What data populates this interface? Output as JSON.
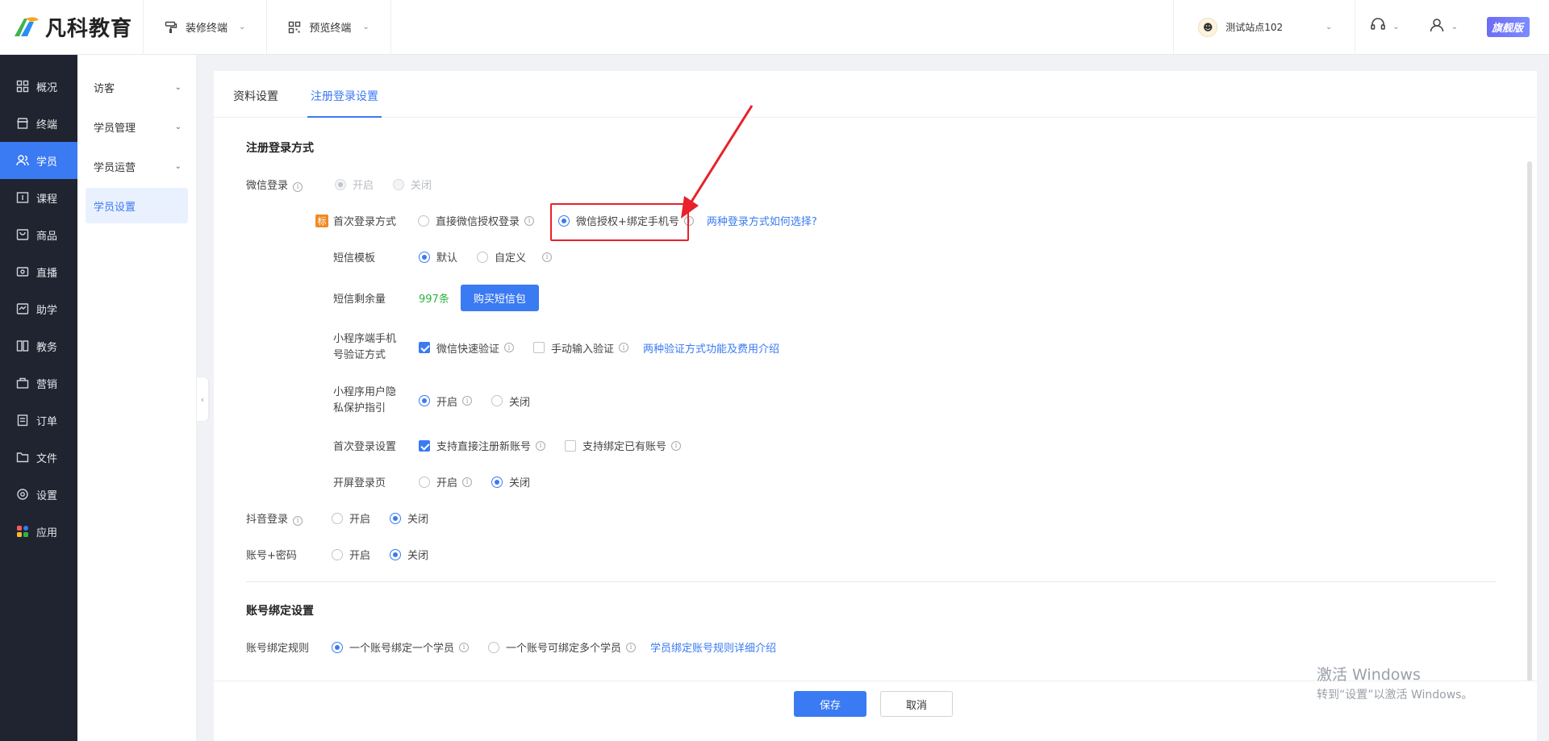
{
  "brand": {
    "name": "凡科教育"
  },
  "topbar": {
    "menus": [
      {
        "label": "装修终端"
      },
      {
        "label": "预览终端"
      }
    ],
    "site": {
      "name": "测试站点102"
    },
    "edition": "旗舰版"
  },
  "leftnav": {
    "items": [
      {
        "label": "概况",
        "icon": "grid-icon"
      },
      {
        "label": "终端",
        "icon": "store-icon"
      },
      {
        "label": "学员",
        "icon": "users-icon",
        "active": true
      },
      {
        "label": "课程",
        "icon": "course-icon"
      },
      {
        "label": "商品",
        "icon": "goods-icon"
      },
      {
        "label": "直播",
        "icon": "live-icon"
      },
      {
        "label": "助学",
        "icon": "assist-icon"
      },
      {
        "label": "教务",
        "icon": "book-icon"
      },
      {
        "label": "营销",
        "icon": "marketing-icon"
      },
      {
        "label": "订单",
        "icon": "order-icon"
      },
      {
        "label": "文件",
        "icon": "folder-icon"
      },
      {
        "label": "设置",
        "icon": "settings-icon"
      },
      {
        "label": "应用",
        "icon": "apps-icon"
      }
    ]
  },
  "subnav": {
    "items": [
      {
        "label": "访客"
      },
      {
        "label": "学员管理"
      },
      {
        "label": "学员运营"
      },
      {
        "label": "学员设置"
      }
    ]
  },
  "tabs": [
    {
      "label": "资料设置"
    },
    {
      "label": "注册登录设置"
    }
  ],
  "form": {
    "section_login": "注册登录方式",
    "wechat_login": {
      "label": "微信登录",
      "on": "开启",
      "off": "关闭"
    },
    "first_login": {
      "tag": "标",
      "label": "首次登录方式",
      "opt1": "直接微信授权登录",
      "opt2": "微信授权+绑定手机号",
      "link": "两种登录方式如何选择?"
    },
    "sms_template": {
      "label": "短信模板",
      "opt1": "默认",
      "opt2": "自定义"
    },
    "sms_balance": {
      "label": "短信剩余量",
      "value": "997条",
      "button": "购买短信包"
    },
    "mp_phone_verify": {
      "label_line1": "小程序端手机",
      "label_line2": "号验证方式",
      "opt1": "微信快速验证",
      "opt2": "手动输入验证",
      "link": "两种验证方式功能及费用介绍"
    },
    "mp_privacy": {
      "label_line1": "小程序用户隐",
      "label_line2": "私保护指引",
      "on": "开启",
      "off": "关闭"
    },
    "first_login_setting": {
      "label": "首次登录设置",
      "opt1": "支持直接注册新账号",
      "opt2": "支持绑定已有账号"
    },
    "splash_login": {
      "label": "开屏登录页",
      "on": "开启",
      "off": "关闭"
    },
    "douyin_login": {
      "label": "抖音登录",
      "on": "开启",
      "off": "关闭"
    },
    "account_password": {
      "label": "账号+密码",
      "on": "开启",
      "off": "关闭"
    },
    "section_bind": "账号绑定设置",
    "bind_rule": {
      "label": "账号绑定规则",
      "opt1": "一个账号绑定一个学员",
      "opt2": "一个账号可绑定多个学员",
      "link": "学员绑定账号规则详细介绍"
    }
  },
  "footer": {
    "save": "保存",
    "cancel": "取消"
  },
  "watermark": {
    "line1": "激活 Windows",
    "line2": "转到“设置”以激活 Windows。"
  },
  "colors": {
    "accent": "#3a7af3",
    "highlight": "#e8212a",
    "sidebar": "#1f2430"
  }
}
